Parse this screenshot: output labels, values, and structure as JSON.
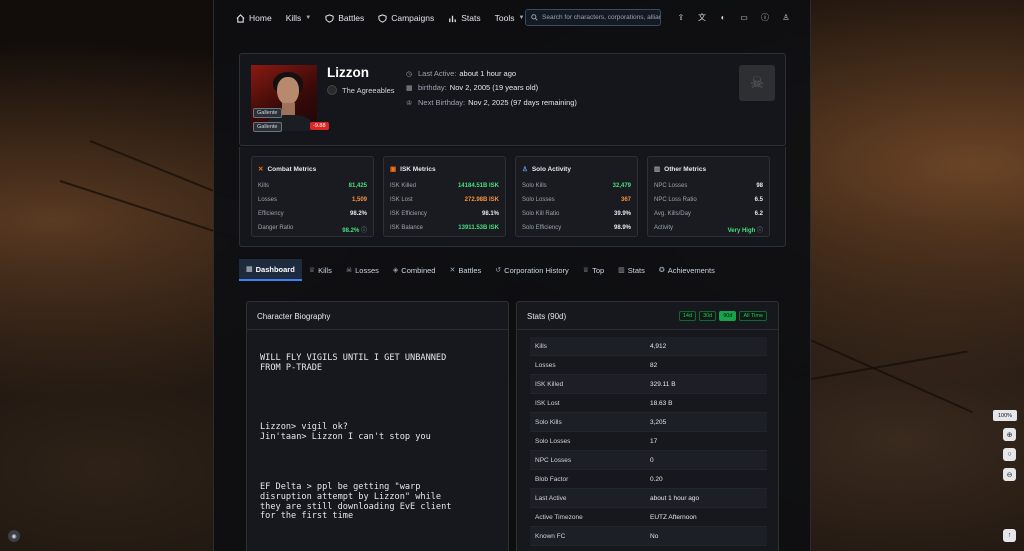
{
  "nav": {
    "home": "Home",
    "kills": "Kills",
    "battles": "Battles",
    "campaigns": "Campaigns",
    "stats": "Stats",
    "tools": "Tools",
    "search_placeholder": "Search for characters, corporations, alliances..."
  },
  "profile": {
    "name": "Lizzon",
    "corporation": "The Agreeables",
    "race_tag_1": "Gallente",
    "race_tag_2": "Gallente",
    "security_status": "-9.88",
    "last_active_label": "Last Active:",
    "last_active_value": "about 1 hour ago",
    "birthday_label": "birthday:",
    "birthday_value": "Nov 2, 2005 (19 years old)",
    "next_birthday_label": "Next Birthday:",
    "next_birthday_value": "Nov 2, 2025 (97 days remaining)"
  },
  "metrics": {
    "combat": {
      "title": "Combat Metrics",
      "rows": [
        {
          "label": "Kills",
          "value": "81,425"
        },
        {
          "label": "Losses",
          "value": "1,509"
        },
        {
          "label": "Efficiency",
          "value": "98.2%"
        },
        {
          "label": "Danger Ratio",
          "value": "98.2%"
        }
      ]
    },
    "isk": {
      "title": "ISK Metrics",
      "rows": [
        {
          "label": "ISK Killed",
          "value": "14184.51B ISK"
        },
        {
          "label": "ISK Lost",
          "value": "272.98B ISK"
        },
        {
          "label": "ISK Efficiency",
          "value": "98.1%"
        },
        {
          "label": "ISK Balance",
          "value": "13911.53B ISK"
        }
      ]
    },
    "solo": {
      "title": "Solo Activity",
      "rows": [
        {
          "label": "Solo Kills",
          "value": "32,479"
        },
        {
          "label": "Solo Losses",
          "value": "367"
        },
        {
          "label": "Solo Kill Ratio",
          "value": "39.9%"
        },
        {
          "label": "Solo Efficiency",
          "value": "98.9%"
        }
      ]
    },
    "other": {
      "title": "Other Metrics",
      "rows": [
        {
          "label": "NPC Losses",
          "value": "98"
        },
        {
          "label": "NPC Loss Ratio",
          "value": "6.5"
        },
        {
          "label": "Avg. Kills/Day",
          "value": "6.2"
        },
        {
          "label": "Activity",
          "value": "Very High"
        }
      ]
    }
  },
  "tabs": [
    {
      "label": "Dashboard"
    },
    {
      "label": "Kills"
    },
    {
      "label": "Losses"
    },
    {
      "label": "Combined"
    },
    {
      "label": "Battles"
    },
    {
      "label": "Corporation History"
    },
    {
      "label": "Top"
    },
    {
      "label": "Stats"
    },
    {
      "label": "Achievements"
    }
  ],
  "biography": {
    "title": "Character Biography",
    "block1": "WILL FLY VIGILS UNTIL I GET UNBANNED\nFROM P-TRADE",
    "block2": "Lizzon> vigil ok?\nJin'taan> Lizzon I can't stop you",
    "block3": "EF Delta > ppl be getting \"warp\ndisruption attempt by Lizzon\" while\nthey are still downloading EvE client\nfor the first time"
  },
  "stats": {
    "title": "Stats (90d)",
    "ranges": [
      "14d",
      "30d",
      "90d",
      "All Time"
    ],
    "rows": [
      {
        "label": "Kills",
        "value": "4,912"
      },
      {
        "label": "Losses",
        "value": "82"
      },
      {
        "label": "ISK Killed",
        "value": "329.11 B"
      },
      {
        "label": "ISK Lost",
        "value": "18.63 B"
      },
      {
        "label": "Solo Kills",
        "value": "3,205"
      },
      {
        "label": "Solo Losses",
        "value": "17"
      },
      {
        "label": "NPC Losses",
        "value": "0"
      },
      {
        "label": "Blob Factor",
        "value": "0.20"
      },
      {
        "label": "Last Active",
        "value": "about 1 hour ago"
      },
      {
        "label": "Active Timezone",
        "value": "EUTZ Afternoon"
      },
      {
        "label": "Known FC",
        "value": "No"
      }
    ]
  },
  "zoom": "100%"
}
